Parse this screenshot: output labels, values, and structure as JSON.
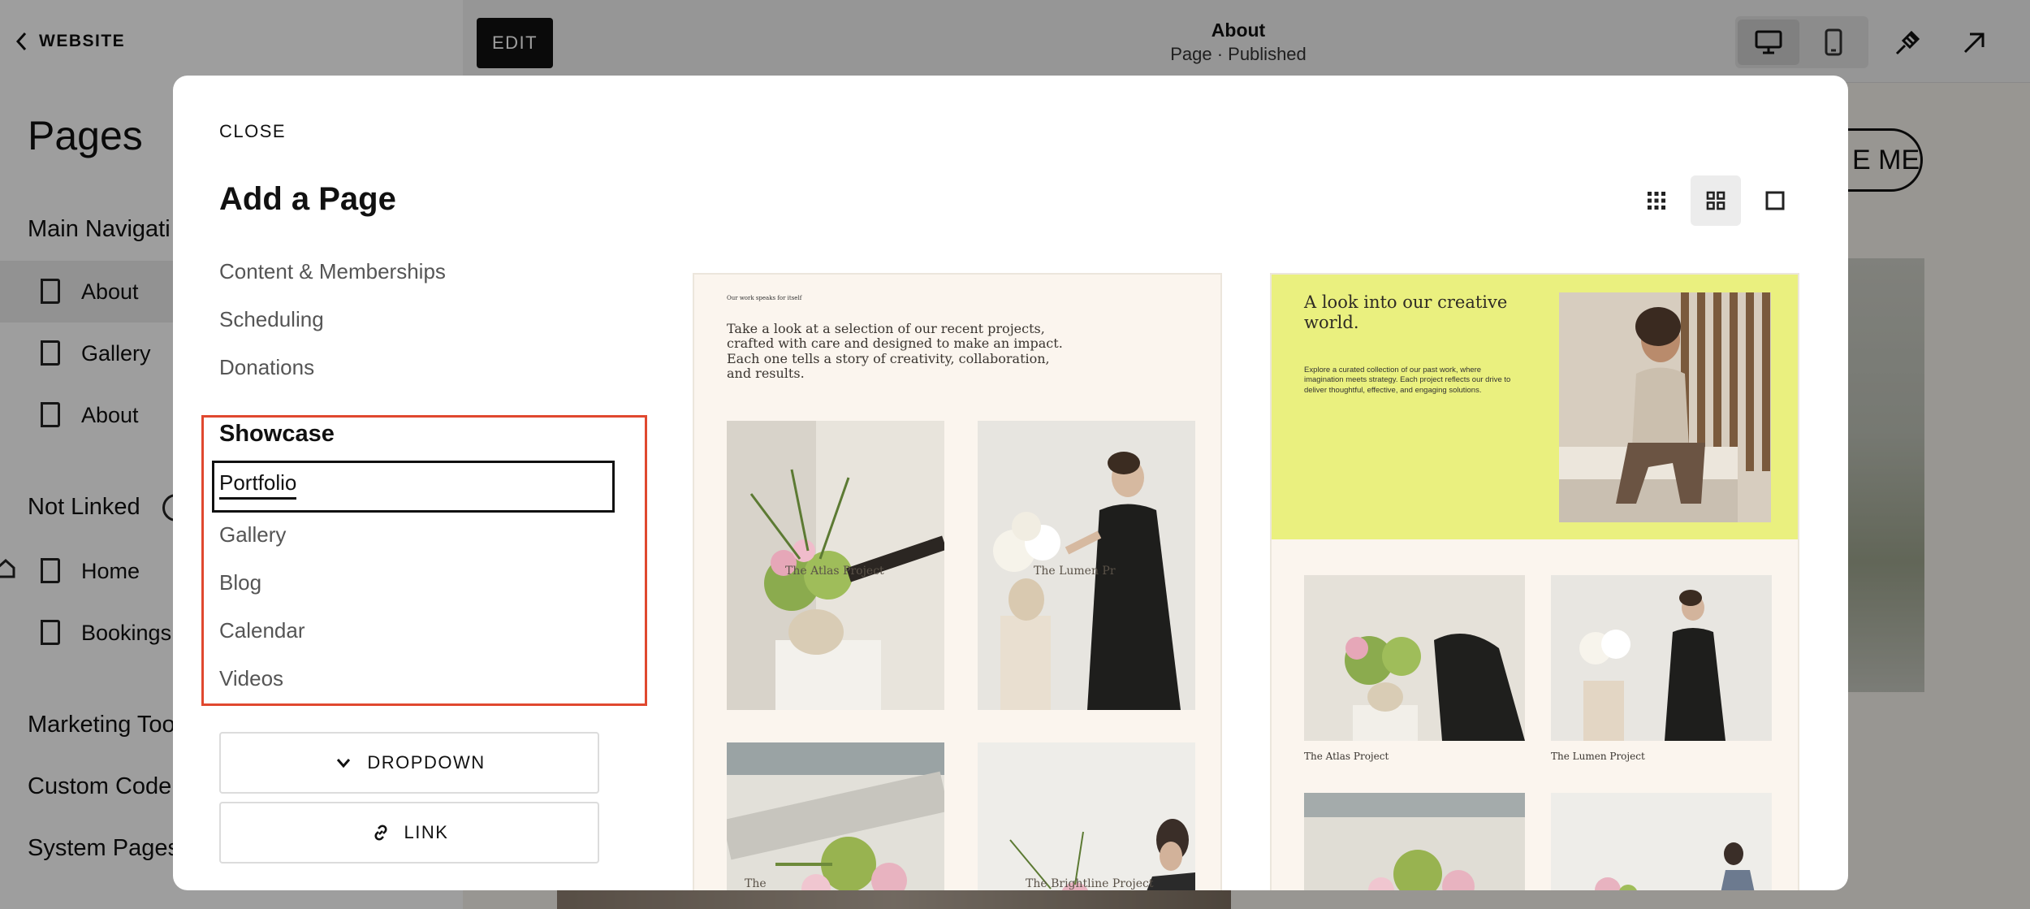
{
  "sidebar": {
    "back_label": "WEBSITE",
    "title": "Pages",
    "sections": {
      "main_navigation": "Main Navigati",
      "not_linked": "Not Linked",
      "marketing_tools": "Marketing Too",
      "custom_code": "Custom Code",
      "system_pages": "System Pages"
    },
    "main_items": [
      "About",
      "Gallery",
      "About"
    ],
    "not_linked_items": [
      "Home",
      "Bookings"
    ]
  },
  "topbar": {
    "edit_label": "EDIT",
    "page_title": "About",
    "page_status": "Page · Published"
  },
  "canvas": {
    "contact_button": "E ME"
  },
  "modal": {
    "close_label": "CLOSE",
    "title": "Add a Page",
    "categories": [
      "Content & Memberships",
      "Scheduling",
      "Donations"
    ],
    "showcase": {
      "heading": "Showcase",
      "items": [
        "Portfolio",
        "Gallery",
        "Blog",
        "Calendar",
        "Videos"
      ],
      "selected": "Portfolio"
    },
    "dropdown_label": "DROPDOWN",
    "link_label": "LINK",
    "view_modes": [
      "small-grid-icon",
      "medium-grid-icon",
      "single-view-icon"
    ],
    "active_view_mode": "medium-grid-icon"
  },
  "templates": [
    {
      "kicker": "Our work speaks for itself",
      "intro": "Take a look at a selection of our recent projects, crafted with care and designed to make an impact. Each one tells a story of creativity, collaboration, and results.",
      "overlay_captions": [
        "The Atlas Project",
        "The Lumen Pr",
        "The",
        "The Brightline Project"
      ]
    },
    {
      "headline": "A look into our creative world.",
      "body": "Explore a curated collection of our past work, where imagination meets strategy. Each project reflects our drive to deliver thoughtful, effective, and engaging solutions.",
      "captions": [
        "The Atlas Project",
        "The Lumen Project"
      ]
    }
  ],
  "colors": {
    "highlight_frame": "#e0482f",
    "template2_accent": "#eaf07f",
    "template_background": "#fbf5ee"
  }
}
